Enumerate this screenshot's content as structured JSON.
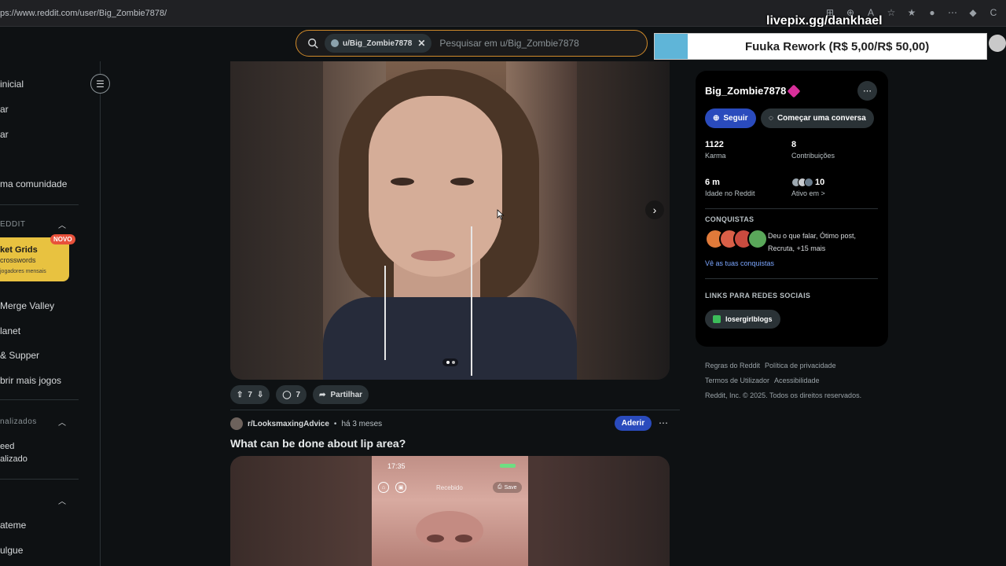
{
  "browser": {
    "url": "ps://www.reddit.com/user/Big_Zombie7878/",
    "overlay_text": "livepix.gg/dankhael",
    "profile_initial": "C"
  },
  "header": {
    "search_chip": "u/Big_Zombie7878",
    "search_placeholder": "Pesquisar em u/Big_Zombie7878"
  },
  "donation": {
    "text": "Fuuka Rework (R$ 5,00/R$ 50,00)",
    "progress": 0.1
  },
  "sidebar": {
    "nav": [
      "inicial",
      "ar",
      "ar",
      "ma comunidade"
    ],
    "games_section": "EDDIT",
    "games_card": {
      "title": "ket Grids",
      "sub": "crosswords",
      "meta": "jogadores mensais",
      "badge": "NOVO"
    },
    "games": [
      "Merge Valley",
      "lanet",
      "& Supper",
      "brir mais jogos"
    ],
    "custom_section": "nalizados",
    "custom_items": [
      "eed",
      "alizado"
    ],
    "bottom_items": [
      "ateme",
      "ulgue"
    ]
  },
  "post1": {
    "upvotes": "7",
    "comments": "7",
    "share_label": "Partilhar"
  },
  "post2": {
    "subreddit": "r/LooksmaxingAdvice",
    "time": "há 3 meses",
    "join_label": "Aderir",
    "title": "What can be done about lip area?",
    "phone_time": "17:35",
    "phone_label": "Recebido",
    "phone_save": "Save"
  },
  "profile": {
    "username": "Big_Zombie7878",
    "follow_label": "Seguir",
    "chat_label": "Começar uma conversa",
    "karma_value": "1122",
    "karma_label": "Karma",
    "contrib_value": "8",
    "contrib_label": "Contribuições",
    "age_value": "6 m",
    "age_label": "Idade no Reddit",
    "active_value": "10",
    "active_label": "Ativo em >",
    "achievements_title": "CONQUISTAS",
    "achievements_text": "Deu o que falar, Ótimo post, Recruta, +15 mais",
    "achievements_link": "Vê as tuas conquistas",
    "social_title": "LINKS PARA REDES SOCIAIS",
    "social_link": "losergirlblogs"
  },
  "footer": {
    "links": [
      "Regras do Reddit",
      "Política de privacidade",
      "Termos de Utilizador",
      "Acessibilidade"
    ],
    "copyright": "Reddit, Inc. © 2025. Todos os direitos reservados."
  },
  "colors": {
    "accent_blue": "#2a4bbd",
    "search_border": "#d18b2a",
    "donation_fill": "#5fb5d8",
    "badge_pink": "#d82f9a"
  }
}
